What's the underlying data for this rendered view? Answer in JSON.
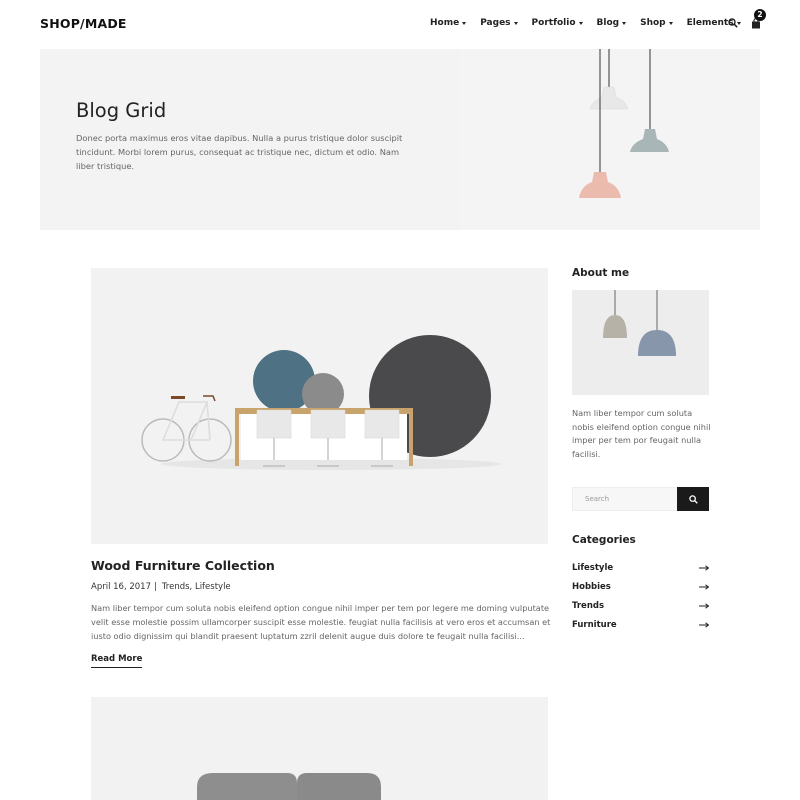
{
  "header": {
    "logo": "SHOP/MADE",
    "nav": [
      "Home",
      "Pages",
      "Portfolio",
      "Blog",
      "Shop",
      "Elements"
    ],
    "cart_count": "2",
    "icons": [
      "search-icon",
      "cart-icon"
    ]
  },
  "hero": {
    "title": "Blog Grid",
    "text": "Donec porta maximus eros vitae dapibus. Nulla a purus tristique dolor suscipit tincidunt. Morbi lorem purus, consequat ac tristique nec, dictum et odio. Nam liber tristique."
  },
  "posts": [
    {
      "title": "Wood Furniture Collection",
      "date": "April 16, 2017",
      "separator": "|",
      "categories": "Trends, Lifestyle",
      "excerpt": "Nam liber tempor cum soluta nobis eleifend option congue nihil imper per tem por legere me doming vulputate velit esse molestie possim ullamcorper suscipit esse molestie. feugiat nulla facilisis at vero eros et accumsan et iusto odio dignissim qui blandit praesent luptatum zzril delenit augue duis dolore te feugait nulla facilisi...",
      "read_more": "Read More"
    }
  ],
  "sidebar": {
    "about_heading": "About me",
    "about_text": "Nam liber tempor cum soluta nobis eleifend option congue nihil imper per tem por feugait nulla facilisi.",
    "search_placeholder": "Search",
    "categories_heading": "Categories",
    "categories": [
      "Lifestyle",
      "Hobbies",
      "Trends",
      "Furniture"
    ]
  },
  "colors": {
    "accent": "#1a1a1a",
    "hero_bg": "#f3f3f3",
    "text_muted": "#666666"
  }
}
